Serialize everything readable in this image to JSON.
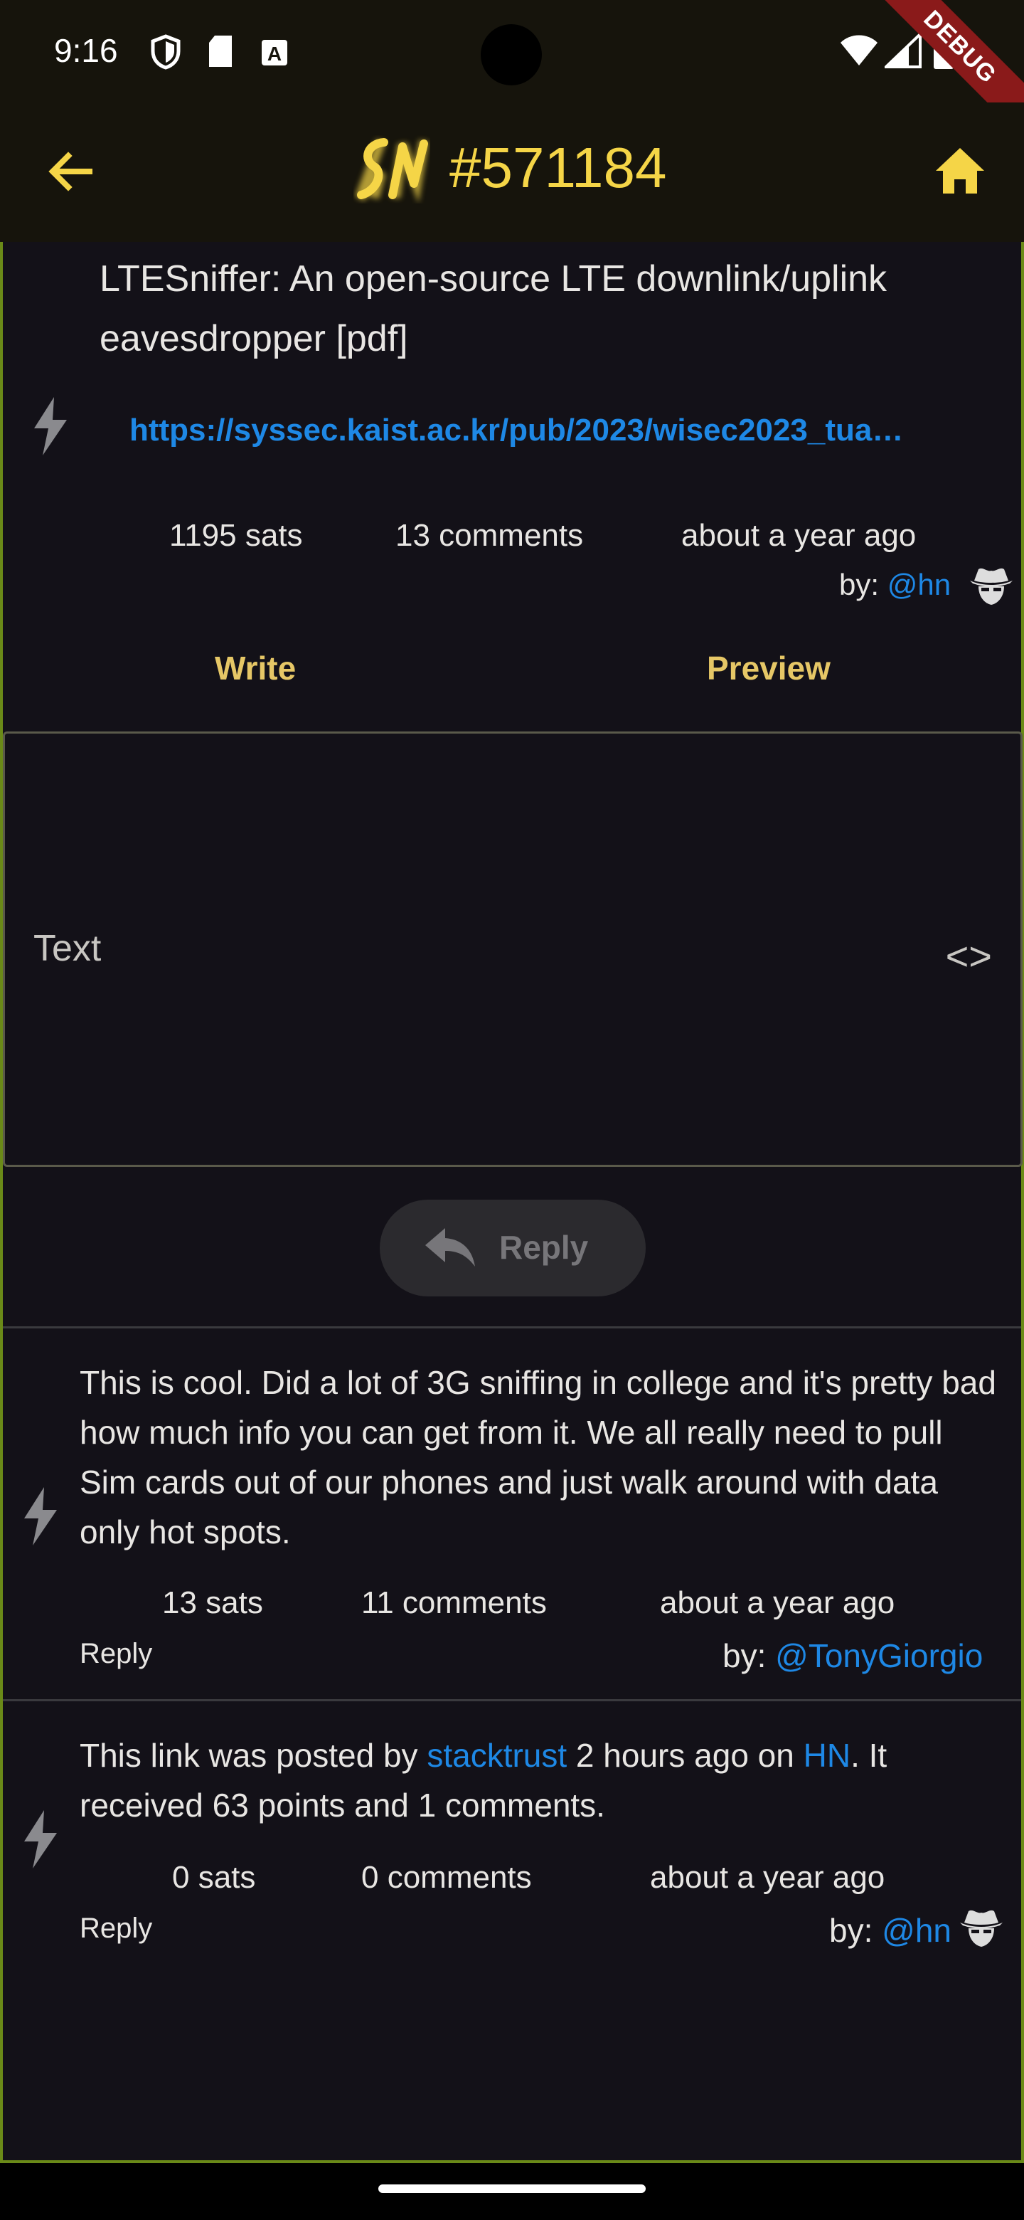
{
  "status_bar": {
    "time": "9:16",
    "debug_label": "DEBUG"
  },
  "app_bar": {
    "title": "#571184"
  },
  "post": {
    "title": "LTESniffer: An open-source LTE downlink/uplink eavesdropper [pdf]",
    "url": "https://syssec.kaist.ac.kr/pub/2023/wisec2023_tua…",
    "sats": "1195 sats",
    "comments": "13 comments",
    "time": "about a year ago",
    "by_prefix": "by:",
    "author": "@hn"
  },
  "tabs": {
    "write": "Write",
    "preview": "Preview"
  },
  "editor": {
    "placeholder": "Text",
    "code_toggle": "<>"
  },
  "reply_button": {
    "label": "Reply"
  },
  "comments": [
    {
      "text": "This is cool. Did a lot of 3G sniffing in college and it's pretty bad how much info you can get from it. We all really need to pull Sim cards out of our phones and just walk around with data only hot spots.",
      "sats": "13 sats",
      "comments": "11 comments",
      "time": "about a year ago",
      "reply": "Reply",
      "by_prefix": "by:",
      "author": "@TonyGiorgio"
    },
    {
      "text_before": "This link was posted by ",
      "link1": "stacktrust",
      "text_middle": " 2 hours ago on ",
      "link2": "HN",
      "text_after": ". It received 63 points and 1 comments.",
      "sats": "0 sats",
      "comments": "0 comments",
      "time": "about a year ago",
      "reply": "Reply",
      "by_prefix": "by:",
      "author": "@hn"
    }
  ],
  "colors": {
    "accent": "#f5d547",
    "link": "#1e88e5",
    "background": "#131118",
    "tab": "#e6c766"
  }
}
